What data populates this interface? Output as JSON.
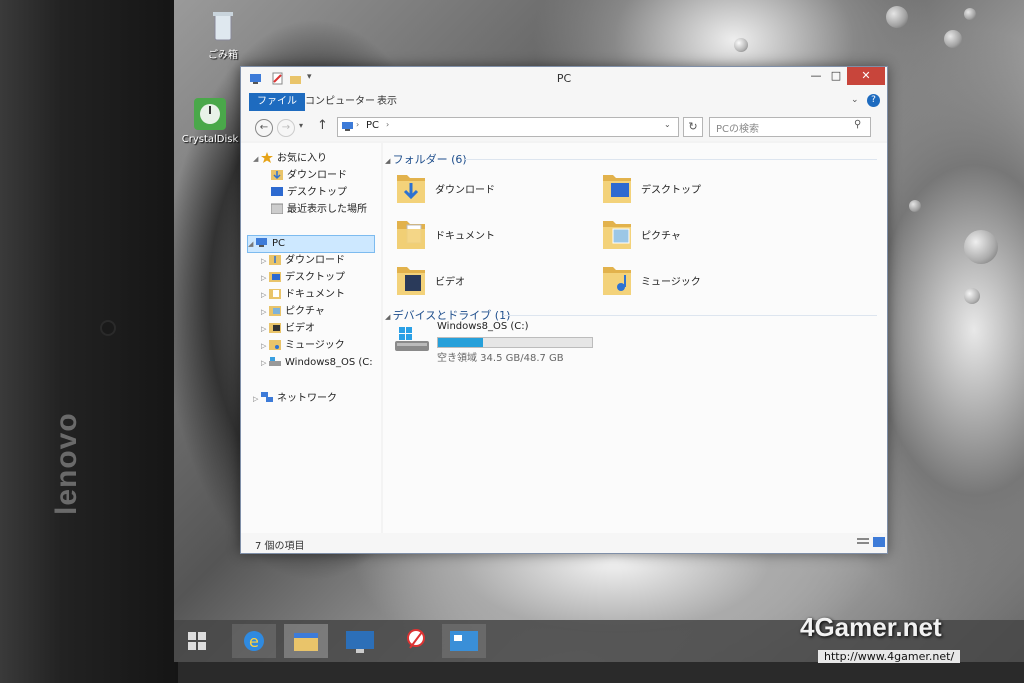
{
  "device": {
    "brand": "lenovo"
  },
  "desktop": {
    "icons": [
      {
        "label": "ごみ箱",
        "icon": "recycle-bin-icon"
      },
      {
        "label": "CrystalDisk",
        "icon": "crystaldisk-icon"
      }
    ]
  },
  "window": {
    "title": "PC",
    "controls": {
      "minimize": "—",
      "maximize": "□",
      "close": "✕"
    },
    "ribbon": {
      "tabs": [
        "ファイル",
        "コンピューター",
        "表示"
      ],
      "help": "?"
    },
    "address": {
      "path": [
        "PC"
      ],
      "separator": "›"
    },
    "search": {
      "placeholder": "PCの検索"
    },
    "nav": {
      "favorites": {
        "label": "お気に入り",
        "items": [
          "ダウンロード",
          "デスクトップ",
          "最近表示した場所"
        ]
      },
      "pc": {
        "label": "PC",
        "items": [
          "ダウンロード",
          "デスクトップ",
          "ドキュメント",
          "ピクチャ",
          "ビデオ",
          "ミュージック",
          "Windows8_OS (C:"
        ]
      },
      "network": {
        "label": "ネットワーク"
      }
    },
    "content": {
      "folders_header": "フォルダー (6)",
      "folders": [
        "ダウンロード",
        "デスクトップ",
        "ドキュメント",
        "ピクチャ",
        "ビデオ",
        "ミュージック"
      ],
      "devices_header": "デバイスとドライブ (1)",
      "drive": {
        "name": "Windows8_OS (C:)",
        "free_text": "空き領域 34.5 GB/48.7 GB",
        "used_fraction": 0.29
      }
    },
    "status": {
      "item_count": "7 個の項目"
    }
  },
  "watermark": {
    "brand": "4Gamer.net",
    "url": "http://www.4gamer.net/"
  },
  "colors": {
    "accent": "#1e6bbf",
    "close": "#c8453b",
    "selection": "#cde8ff",
    "drive_bar": "#26a0da"
  }
}
